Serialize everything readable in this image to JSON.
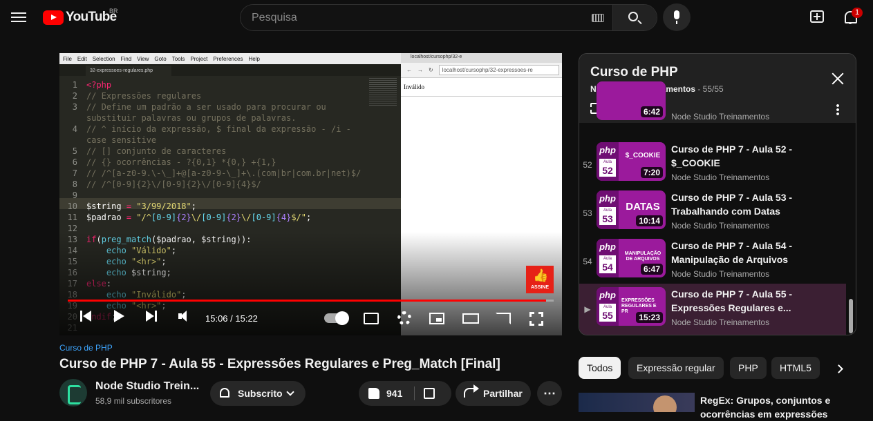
{
  "masthead": {
    "logo_text": "YouTube",
    "country": "BR",
    "search_placeholder": "Pesquisa",
    "notifications": "1"
  },
  "player": {
    "editor_menu": [
      "File",
      "Edit",
      "Selection",
      "Find",
      "View",
      "Goto",
      "Tools",
      "Project",
      "Preferences",
      "Help"
    ],
    "editor_tab": "32-expressoes-regulares.php",
    "code_lines": [
      "1",
      "2",
      "3",
      "",
      "4",
      "",
      "5",
      "6",
      "7",
      "8",
      "9",
      "10",
      "11",
      "12",
      "13",
      "14",
      "15",
      "16",
      "17",
      "18",
      "19",
      "20",
      "21"
    ],
    "browser_tab": "localhost/cursophp/32-e",
    "browser_url": "localhost/cursophp/32-expressoes-re",
    "browser_body": "Inválido",
    "assine": "ASSINE",
    "time": "15:06 / 15:22",
    "progress": 0.985
  },
  "video": {
    "playlist_link": "Curso de PHP",
    "title": "Curso de PHP 7 - Aula 55 - Expressões Regulares e Preg_Match [Final]",
    "channel": "Node Studio Trein...",
    "subscribers": "58,9 mil subscritores",
    "subscribe_label": "Subscrito",
    "likes": "941",
    "share_label": "Partilhar",
    "more": "⋯"
  },
  "playlist": {
    "title": "Curso de PHP",
    "owner": "Node Studio Treinamentos",
    "position": " - 55/55",
    "partial_item": {
      "duration": "6:42",
      "channel": "Node Studio Treinamentos"
    },
    "items": [
      {
        "index": "52",
        "thumb_topic": "$_COOKIE",
        "aula": "52",
        "duration": "7:20",
        "title": "Curso de PHP 7 - Aula 52 - $_COOKIE",
        "channel": "Node Studio Treinamentos"
      },
      {
        "index": "53",
        "thumb_topic": "DATAS",
        "aula": "53",
        "duration": "10:14",
        "title": "Curso de PHP 7 - Aula 53 - Trabalhando com Datas",
        "channel": "Node Studio Treinamentos"
      },
      {
        "index": "54",
        "thumb_topic": "MANIPULAÇÃO DE ARQUIVOS",
        "aula": "54",
        "duration": "6:47",
        "title": "Curso de PHP 7 - Aula 54 - Manipulação de Arquivos",
        "channel": "Node Studio Treinamentos"
      },
      {
        "index": "▶",
        "thumb_topic": "EXPRESSÕES REGULARES E PR",
        "aula": "55",
        "duration": "15:23",
        "title": "Curso de PHP 7 - Aula 55 - Expressões Regulares e...",
        "channel": "Node Studio Treinamentos"
      }
    ],
    "thumb_php": "php",
    "thumb_aula": "Aula"
  },
  "chips": [
    "Todos",
    "Expressão regular",
    "PHP",
    "HTML5"
  ],
  "related": {
    "title": "RegEx: Grupos, conjuntos e ocorrências em expressões"
  },
  "colors": {
    "accent": "#ff0000",
    "link": "#3ea6ff",
    "active_item": "#3b1f33"
  }
}
